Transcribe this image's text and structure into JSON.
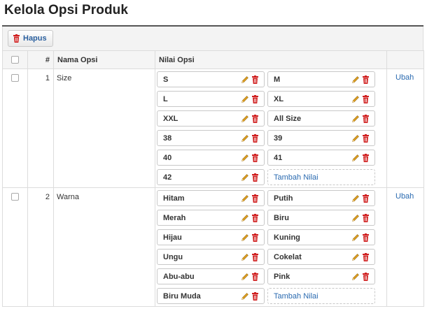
{
  "page": {
    "title": "Kelola Opsi Produk"
  },
  "toolbar": {
    "delete_label": "Hapus"
  },
  "table": {
    "headers": {
      "number": "#",
      "name": "Nama Opsi",
      "values": "Nilai Opsi"
    },
    "add_value_label": "Tambah Nilai",
    "action_label": "Ubah",
    "rows": [
      {
        "number": "1",
        "name": "Size",
        "values": [
          "S",
          "M",
          "L",
          "XL",
          "XXL",
          "All Size",
          "38",
          "39",
          "40",
          "41",
          "42"
        ]
      },
      {
        "number": "2",
        "name": "Warna",
        "values": [
          "Hitam",
          "Putih",
          "Merah",
          "Biru",
          "Hijau",
          "Kuning",
          "Ungu",
          "Cokelat",
          "Abu-abu",
          "Pink",
          "Biru Muda"
        ]
      }
    ]
  },
  "colors": {
    "pencil": "#e0a020",
    "trash": "#d02020",
    "link": "#2a6ab0"
  },
  "icons": {
    "edit": "pencil-icon",
    "delete": "trash-icon"
  }
}
